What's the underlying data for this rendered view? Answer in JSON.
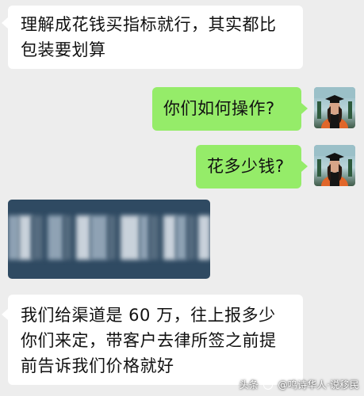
{
  "messages": [
    {
      "side": "in",
      "lines": [
        "理解成花钱买指标就行，其实都比",
        "包装要划算"
      ]
    },
    {
      "side": "out",
      "text": "你们如何操作?"
    },
    {
      "side": "out",
      "text": "花多少钱?"
    },
    {
      "side": "in",
      "type": "card",
      "blurred": true
    },
    {
      "side": "in",
      "lines": [
        "我们给渠道是 60 万，往上报多少",
        "你们来定，带客户去律所签之前提",
        "前告诉我们价格就好"
      ]
    }
  ],
  "avatar_icon": "graduate-avatar-icon",
  "watermark": {
    "prefix": "头条",
    "name": "@鸣诗华人·说移民"
  },
  "colors": {
    "background": "#ededed",
    "incoming_bubble": "#ffffff",
    "outgoing_bubble": "#95ec69",
    "card": "#2f4a62"
  }
}
